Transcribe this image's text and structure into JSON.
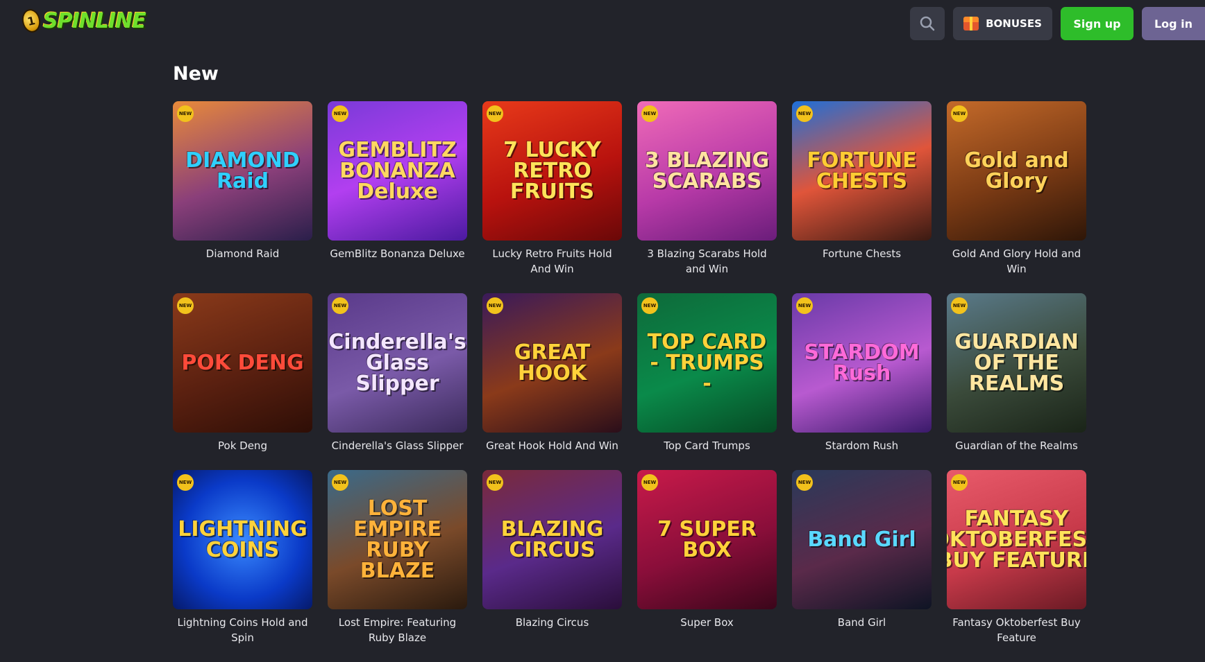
{
  "header": {
    "logo_text": "SPINLINE",
    "logo_coin": "1",
    "bonus_label": "BONUSES",
    "signup_label": "Sign up",
    "login_label": "Log in",
    "search_icon": "search-icon",
    "bonus_icon": "gift-icon"
  },
  "section": {
    "title": "New"
  },
  "badge_text": "NEW",
  "games": [
    {
      "title": "Diamond Raid",
      "art": "DIAMOND Raid",
      "bg": "linear-gradient(160deg,#e88a3a,#8a3f7a 55%,#2a1f4a)",
      "fg": "#2fd0ff"
    },
    {
      "title": "GemBlitz Bonanza Deluxe",
      "art": "GEMBLITZ BONANZA Deluxe",
      "bg": "linear-gradient(160deg,#7a3ad8,#b23ff0 50%,#4b1aa0)",
      "fg": "#ffd860"
    },
    {
      "title": "Lucky Retro Fruits Hold And Win",
      "art": "7 LUCKY RETRO FRUITS",
      "bg": "linear-gradient(160deg,#e83a1a,#b8120e 55%,#6a0808)",
      "fg": "#ffe35a"
    },
    {
      "title": "3 Blazing Scarabs Hold and Win",
      "art": "3 BLAZING SCARABS",
      "bg": "linear-gradient(160deg,#f06bb8,#b83aa8 55%,#6a1d7a)",
      "fg": "#ffe3a0"
    },
    {
      "title": "Fortune Chests",
      "art": "FORTUNE CHESTS",
      "bg": "linear-gradient(160deg,#1e6fd8,#e0553a 50%,#3a1a12)",
      "fg": "#ffcc33"
    },
    {
      "title": "Gold And Glory Hold and Win",
      "art": "Gold and Glory",
      "bg": "linear-gradient(160deg,#c46a2a,#7a3a14 55%,#2e1608)",
      "fg": "#ffd25a"
    },
    {
      "title": "Pok Deng",
      "art": "POK DENG",
      "bg": "linear-gradient(160deg,#8a3a1a,#5a2010 55%,#2e0e06)",
      "fg": "#ff4b3a"
    },
    {
      "title": "Cinderella's Glass Slipper",
      "art": "Cinderella's Glass Slipper",
      "bg": "linear-gradient(160deg,#5a3a8a,#7a5aa8 55%,#3a2a5a)",
      "fg": "#f4e6ff"
    },
    {
      "title": "Great Hook Hold And Win",
      "art": "GREAT HOOK",
      "bg": "linear-gradient(160deg,#3a1a5a,#8a3a1a 55%,#2a0e1a)",
      "fg": "#ffd23a"
    },
    {
      "title": "Top Card Trumps",
      "art": "TOP CARD - TRUMPS -",
      "bg": "linear-gradient(160deg,#0e6a3a,#0a8a4a 55%,#064a24)",
      "fg": "#ffd23a"
    },
    {
      "title": "Stardom Rush",
      "art": "STARDOM Rush",
      "bg": "linear-gradient(160deg,#6a3aa8,#b85ad0 55%,#3a1a6a)",
      "fg": "#ff6ad8"
    },
    {
      "title": "Guardian of the Realms",
      "art": "GUARDIAN OF THE REALMS",
      "bg": "linear-gradient(160deg,#5a7a8a,#3a4a3a 55%,#1a2418)",
      "fg": "#ffe6a0"
    },
    {
      "title": "Lightning Coins Hold and Spin",
      "art": "LIGHTNING COINS",
      "bg": "radial-gradient(circle,#3a8aff,#0a3ac8 60%,#061a6a)",
      "fg": "#ffd23a"
    },
    {
      "title": "Lost Empire: Featuring Ruby Blaze",
      "art": "LOST EMPIRE RUBY BLAZE",
      "bg": "linear-gradient(160deg,#3a6a8a,#7a4a2a 55%,#2a1a0e)",
      "fg": "#ffb23a"
    },
    {
      "title": "Blazing Circus",
      "art": "BLAZING CIRCUS",
      "bg": "linear-gradient(160deg,#7a2a3a,#5a2a8a 55%,#2a0e3a)",
      "fg": "#ffd23a"
    },
    {
      "title": "Super Box",
      "art": "7 SUPER BOX",
      "bg": "linear-gradient(160deg,#c81a4a,#8a0e3a 55%,#3a061a)",
      "fg": "#ffd23a"
    },
    {
      "title": "Band Girl",
      "art": "Band Girl",
      "bg": "linear-gradient(160deg,#2a3a5a,#5a2a4a 55%,#0e1424)",
      "fg": "#5ad8ff"
    },
    {
      "title": "Fantasy Oktoberfest Buy Feature",
      "art": "FANTASY OKTOBERFEST BUY FEATURE",
      "bg": "linear-gradient(160deg,#e85a6a,#c83a4a 55%,#6a1a24)",
      "fg": "#ffe35a"
    }
  ]
}
